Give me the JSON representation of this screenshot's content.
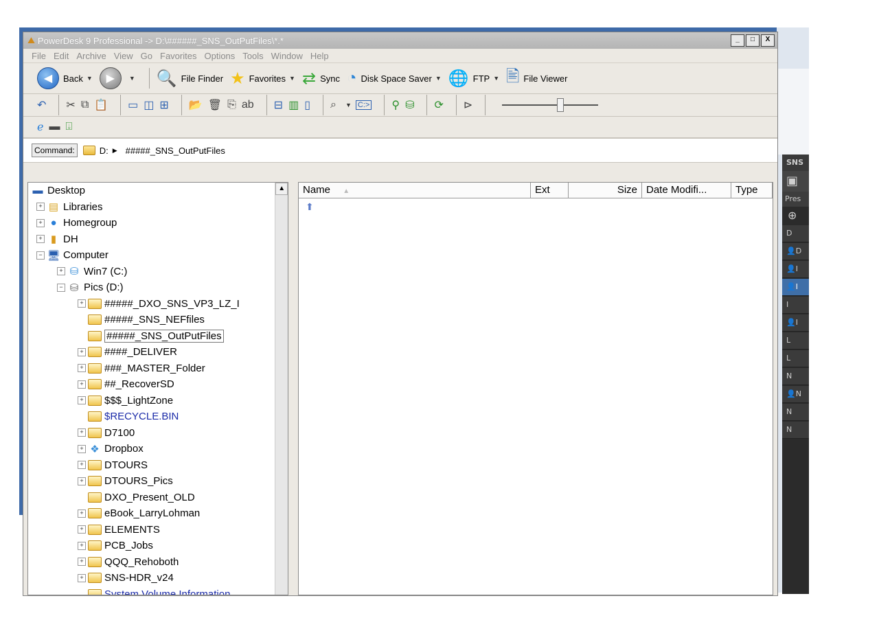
{
  "window": {
    "title": "PowerDesk 9 Professional -> D:\\######_SNS_OutPutFiles\\*.*",
    "buttons": [
      "_",
      "□",
      "X"
    ]
  },
  "menu": [
    "File",
    "Edit",
    "Archive",
    "View",
    "Go",
    "Favorites",
    "Options",
    "Tools",
    "Window",
    "Help"
  ],
  "toolbar": {
    "back": "Back",
    "file_finder": "File Finder",
    "favorites": "Favorites",
    "sync": "Sync",
    "disk_space_saver": "Disk Space Saver",
    "ftp": "FTP",
    "file_viewer": "File Viewer",
    "cmd_prompt": "C:>"
  },
  "command": {
    "label": "Command:",
    "drive": "D:",
    "folder": "#####_SNS_OutPutFiles"
  },
  "tree": {
    "items": [
      {
        "label": "Desktop"
      },
      {
        "label": "Libraries"
      },
      {
        "label": "Homegroup"
      },
      {
        "label": "DH"
      },
      {
        "label": "Computer"
      },
      {
        "label": "Win7 (C:)"
      },
      {
        "label": "Pics (D:)"
      },
      {
        "label": "#####_DXO_SNS_VP3_LZ_I"
      },
      {
        "label": "#####_SNS_NEFfiles"
      },
      {
        "label": "#####_SNS_OutPutFiles"
      },
      {
        "label": "####_DELIVER"
      },
      {
        "label": "###_MASTER_Folder"
      },
      {
        "label": "##_RecoverSD"
      },
      {
        "label": "$$$_LightZone"
      },
      {
        "label": "$RECYCLE.BIN"
      },
      {
        "label": "D7100"
      },
      {
        "label": "Dropbox"
      },
      {
        "label": "DTOURS"
      },
      {
        "label": "DTOURS_Pics"
      },
      {
        "label": "DXO_Present_OLD"
      },
      {
        "label": "eBook_LarryLohman"
      },
      {
        "label": "ELEMENTS"
      },
      {
        "label": "PCB_Jobs"
      },
      {
        "label": "QQQ_Rehoboth"
      },
      {
        "label": "SNS-HDR_v24"
      },
      {
        "label": "System Volume Information"
      }
    ]
  },
  "list": {
    "columns": [
      "Name",
      "Ext",
      "Size",
      "Date Modifi...",
      "Type"
    ]
  },
  "sns_panel": {
    "title": "SNS",
    "preset_label": "Pres",
    "rows": [
      "D",
      "D",
      "I",
      "I",
      "I",
      "I",
      "L",
      "L",
      "N",
      "N",
      "N",
      "N"
    ]
  }
}
